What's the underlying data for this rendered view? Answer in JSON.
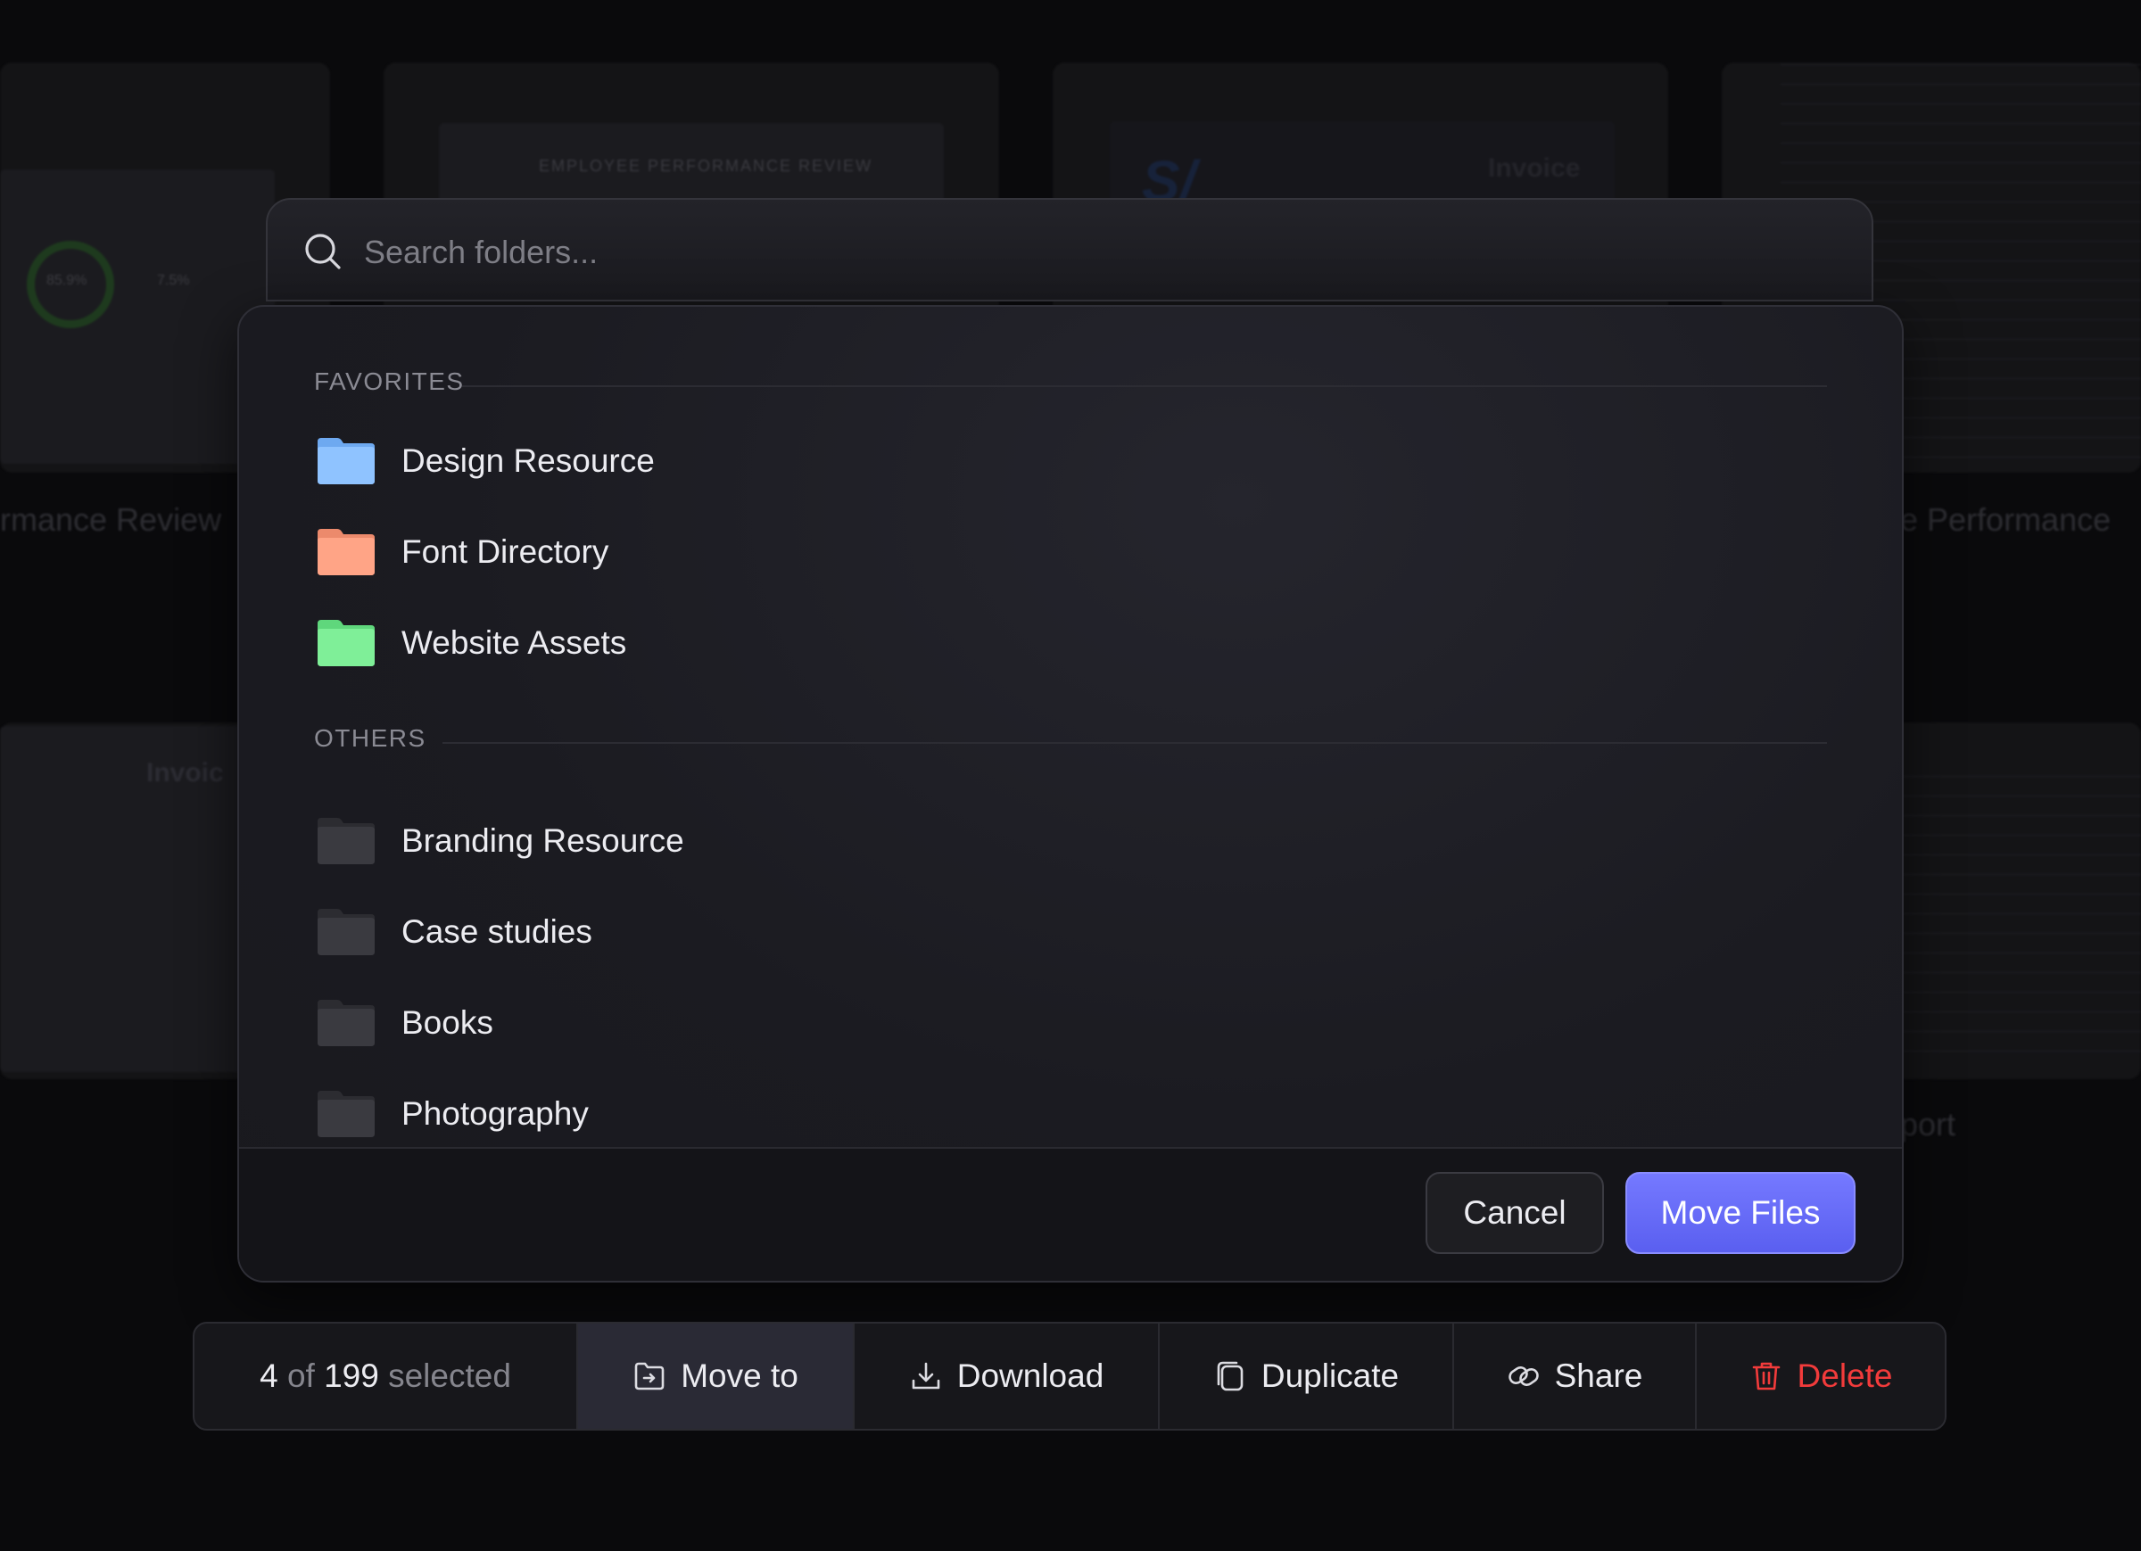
{
  "background": {
    "card_titles": [
      "rmance Review",
      "e Performance",
      "port"
    ],
    "doc_headings": [
      "EMPLOYEE PERFORMANCE REVIEW",
      "Invoice",
      "Invoic"
    ],
    "ring_values": [
      "85.9%",
      "7.5%"
    ]
  },
  "search": {
    "placeholder": "Search folders..."
  },
  "favorites": {
    "label": "FAVORITES",
    "folders": [
      {
        "name": "Design Resource",
        "color": "#8fc3ff"
      },
      {
        "name": "Font Directory",
        "color": "#ffa486"
      },
      {
        "name": "Website Assets",
        "color": "#7fef98"
      }
    ]
  },
  "others": {
    "label": "OTHERS",
    "folders": [
      {
        "name": "Branding Resource",
        "color": "#3a3a40"
      },
      {
        "name": "Case studies",
        "color": "#3a3a40"
      },
      {
        "name": "Books",
        "color": "#3a3a40"
      },
      {
        "name": "Photography",
        "color": "#3a3a40"
      }
    ]
  },
  "dialog": {
    "cancel_label": "Cancel",
    "confirm_label": "Move Files",
    "confirm_color": "#6368f8"
  },
  "action_bar": {
    "selected_count": "4",
    "of_text": "of",
    "total_count": "199",
    "selected_text": "selected",
    "move_label": "Move to",
    "download_label": "Download",
    "duplicate_label": "Duplicate",
    "share_label": "Share",
    "delete_label": "Delete",
    "delete_color": "#f23b3b"
  }
}
